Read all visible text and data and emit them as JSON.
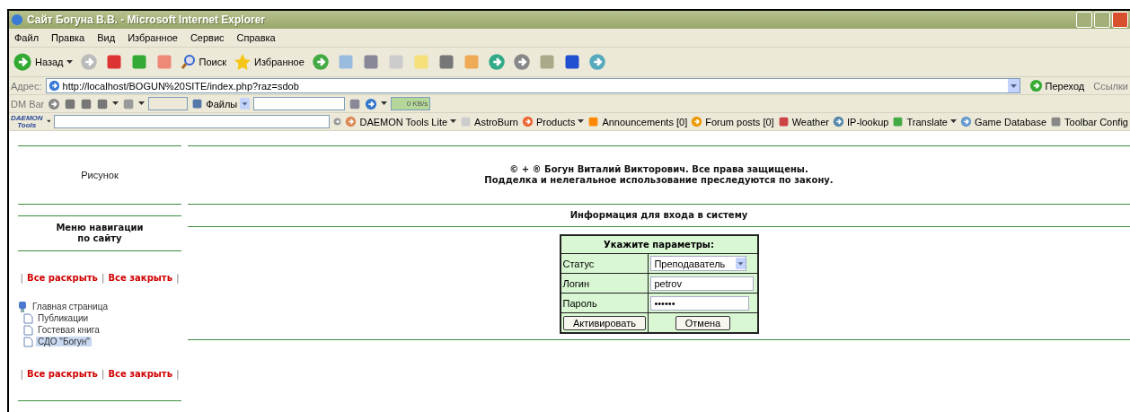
{
  "window": {
    "title": "Сайт Богуна В.В. - Microsoft Internet Explorer"
  },
  "menu": [
    "Файл",
    "Правка",
    "Вид",
    "Избранное",
    "Сервис",
    "Справка"
  ],
  "toolbar": {
    "back": "Назад",
    "search": "Поиск",
    "favorites": "Избранное"
  },
  "address": {
    "label": "Адрес:",
    "url": "http://localhost/BOGUN%20SITE/index.php?raz=sdob",
    "go": "Переход",
    "links": "Ссылки"
  },
  "dm_bar": {
    "label": "DM Bar",
    "files": "Файлы",
    "speed": "0 KB/s"
  },
  "daemon_bar": {
    "logo": [
      "DAEMON",
      "Tools"
    ],
    "items": [
      {
        "label": "DAEMON Tools Lite",
        "dropdown": true
      },
      {
        "label": "AstroBurn",
        "dropdown": false
      },
      {
        "label": "Products",
        "dropdown": true
      },
      {
        "label": "Announcements [0]",
        "dropdown": false
      },
      {
        "label": "Forum posts [0]",
        "dropdown": false
      },
      {
        "label": "Weather",
        "dropdown": false
      },
      {
        "label": "IP-lookup",
        "dropdown": false
      },
      {
        "label": "Translate",
        "dropdown": true
      },
      {
        "label": "Game Database",
        "dropdown": false
      },
      {
        "label": "Toolbar Config",
        "dropdown": false
      }
    ]
  },
  "page": {
    "picture_label": "Рисунок",
    "copyright": [
      "© + ® Богун Виталий Викторович. Все права защищены.",
      "Подделка и нелегальное использование преследуются по закону."
    ],
    "login_title": "Информация для входа в систему",
    "nav_title": [
      "Меню навигации",
      "по сайту"
    ],
    "nav_separator": "|",
    "nav_links_top": [
      "Все раскрыть",
      "Все закрыть"
    ],
    "nav_links_bottom": [
      "Все раскрыть",
      "Все закрыть"
    ],
    "tree": [
      {
        "label": "Главная страница",
        "selected": false,
        "children": [
          {
            "label": "Публикации",
            "selected": false
          },
          {
            "label": "Гостевая книга",
            "selected": false
          },
          {
            "label": "СДО \"Богун\"",
            "selected": true
          }
        ]
      }
    ],
    "form": {
      "title": "Укажите параметры:",
      "rows": [
        {
          "kind": "select",
          "label": "Статус",
          "value": "Преподаватель"
        },
        {
          "kind": "text",
          "label": "Логин",
          "value": "petrov"
        },
        {
          "kind": "password",
          "label": "Пароль",
          "value": "••••••"
        }
      ],
      "submit": "Активировать",
      "cancel": "Отмена"
    }
  }
}
